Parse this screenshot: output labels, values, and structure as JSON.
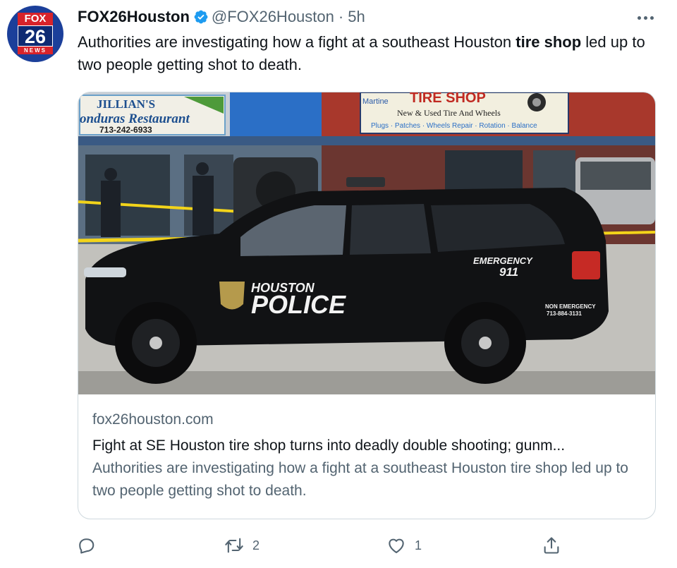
{
  "account": {
    "display_name": "FOX26Houston",
    "handle": "@FOX26Houston",
    "separator": "·",
    "time": "5h",
    "avatar": {
      "brand_top": "FOX",
      "brand_number": "26",
      "brand_sub": "NEWS"
    }
  },
  "tweet": {
    "text_before": "Authorities are investigating how a fight at a southeast Houston ",
    "text_bold": "tire shop",
    "text_after": " led up to two people getting shot to death."
  },
  "card": {
    "image": {
      "restaurant_sign_line1": "JILLIAN'S",
      "restaurant_sign_line2": "onduras Restaurant",
      "restaurant_sign_phone": "713-242-6933",
      "shop_sign_small": "Martine",
      "shop_sign_title": "TIRE SHOP",
      "shop_sign_line2": "New & Used Tire And Wheels",
      "shop_sign_line3": "Plugs · Patches · Wheels Repair · Rotation · Balance",
      "vehicle_text_houston": "HOUSTON",
      "vehicle_text_police": "POLICE",
      "vehicle_text_emergency": "EMERGENCY",
      "vehicle_text_911": "911",
      "vehicle_text_non_emergency": "NON EMERGENCY",
      "vehicle_text_phone": "713-884-3131"
    },
    "domain": "fox26houston.com",
    "title": "Fight at SE Houston tire shop turns into deadly double shooting; gunm...",
    "description": "Authorities are investigating how a fight at a southeast Houston tire shop led up to two people getting shot to death."
  },
  "actions": {
    "reply": {
      "icon": "reply-icon",
      "count": ""
    },
    "retweet": {
      "icon": "retweet-icon",
      "count": "2"
    },
    "like": {
      "icon": "heart-icon",
      "count": "1"
    },
    "share": {
      "icon": "share-icon",
      "count": ""
    }
  },
  "colors": {
    "verified": "#1d9bf0",
    "secondary_text": "#536471",
    "border": "#cfd9de"
  }
}
